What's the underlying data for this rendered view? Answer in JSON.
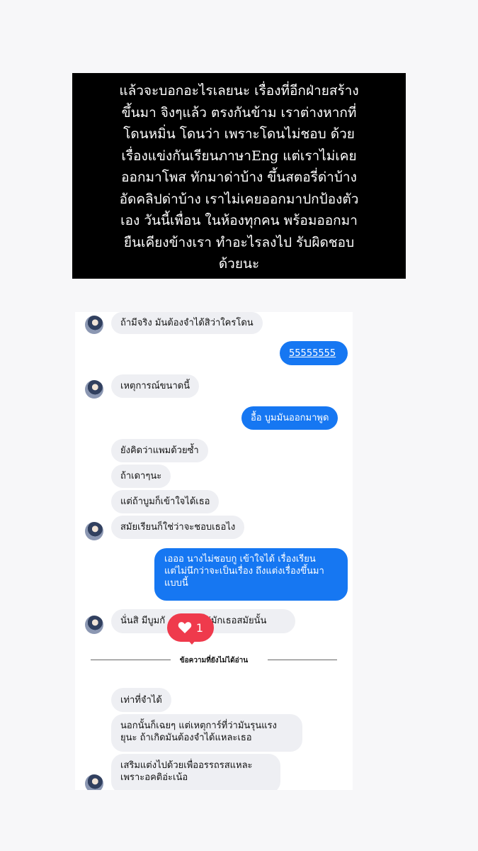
{
  "caption": {
    "lines": [
      "แล้วจะบอกอะไรเลยนะ เรื่องที่อีกฝ่ายสร้าง",
      "ขึ้นมา จิงๆแล้ว ตรงกันข้าม เราต่างหากที่",
      "โดนหมิ่น โดนว่า เพราะโดนไม่ชอบ ด้วย",
      "เรื่องแข่งกันเรียนภาษาEng แต่เราไม่เคย",
      "ออกมาโพส ทักมาด่าบ้าง ขึ้นสตอรี่ด่าบ้าง",
      "อัดคลิปด่าบ้าง เราไม่เคยออกมาปกป้องตัว",
      "เอง วันนี้เพื่อน ในห้องทุกคน พร้อมออกมา",
      "ยืนเคียงข้างเรา ทำอะไรลงไป รับผิดชอบ",
      "ด้วยนะ"
    ]
  },
  "chat": {
    "messages": [
      {
        "side": "received",
        "text": "ถ้ามีจริง มันต้องจำได้สิว่าใครโดน"
      },
      {
        "side": "sent",
        "text": "55555555"
      },
      {
        "side": "received",
        "text": "เหตุการณ์ขนาดนี้"
      },
      {
        "side": "sent",
        "text": "อื้อ บูมมันออกมาพูด"
      },
      {
        "side": "received",
        "text": "ยังคิดว่าแพมด้วยซ้ำ"
      },
      {
        "side": "received",
        "text": "ถ้าเดาๆนะ"
      },
      {
        "side": "received",
        "text": "แต่ถ้าบูมก็เข้าใจได้เธอ"
      },
      {
        "side": "received",
        "text": "สมัยเรียนก็ใช่ว่าจะชอบเธอไง"
      },
      {
        "side": "sent",
        "line1": "เอออ นางไม่ชอบกู เข้าใจได้ เรื่องเรียน",
        "line2": "แต่ไม่นึกว่าจะเป็นเรื่อง ถึงแต่งเรื่องขึ้นมา",
        "line3": "แบบนี้"
      },
      {
        "side": "received",
        "text": "นั่นสิ มีบูมกั",
        "text_tail": "ที่บ่มักเธอสมัยนั้น"
      },
      {
        "side": "received",
        "text": "เท่าที่จำได้"
      },
      {
        "side": "received",
        "line1": "นอกนั้นก็เฉยๆ แต่เหตุการ์ที่ว่ามันรุนแรง",
        "line2": "ยุนะ ถ้าเกิดมันต้องจำได้แหละเธอ"
      },
      {
        "side": "received",
        "line1": "เสริมแต่งไปด้วยเพื่ออรรถรสแหละ",
        "line2": "เพราะอคติอ่ะเน้อ"
      }
    ],
    "reaction": {
      "icon": "heart-icon",
      "count": "1",
      "color": "#ef3a4c"
    },
    "unread_divider": "ข้อความที่ยังไม่ได้อ่าน",
    "colors": {
      "sent_bubble": "#1677f2",
      "received_bubble": "#eeeff3"
    }
  }
}
